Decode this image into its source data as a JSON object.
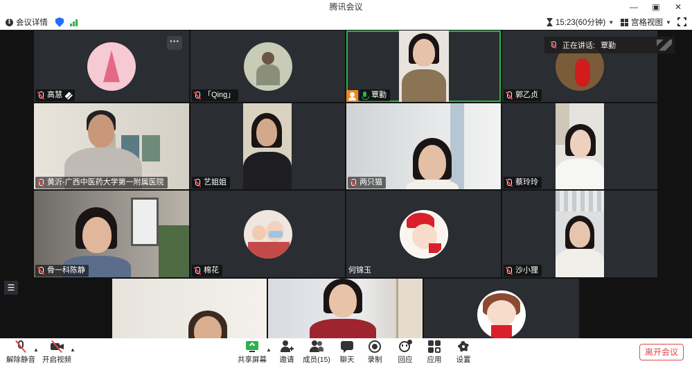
{
  "window": {
    "title": "腾讯会议",
    "controls": [
      "—",
      "▣",
      "✕"
    ]
  },
  "infobar": {
    "meeting_info_label": "会议详情",
    "timer_text": "15:23(60分钟)",
    "view_label": "宫格视图"
  },
  "speaker": {
    "prefix": "正在讲话:",
    "name": "覃勤"
  },
  "participants": [
    {
      "name": "高慧"
    },
    {
      "name": "「Qing」"
    },
    {
      "name": "覃勤"
    },
    {
      "name": "郭乙贞"
    },
    {
      "name": "黄沂-广西中医药大学第一附属医院"
    },
    {
      "name": "艺姐姐"
    },
    {
      "name": "两只猫"
    },
    {
      "name": "蔡玲玲"
    },
    {
      "name": "骨一科陈静"
    },
    {
      "name": "棉花"
    },
    {
      "name": "何锦玉"
    },
    {
      "name": "沙小狸"
    }
  ],
  "toolbar": {
    "unmute": "解除静音",
    "start_video": "开启视频",
    "share_screen": "共享屏幕",
    "invite": "邀请",
    "members": "成员(15)",
    "chat": "聊天",
    "record": "录制",
    "reaction": "回应",
    "apps": "应用",
    "settings": "设置",
    "leave": "离开会议"
  },
  "colors": {
    "speaking_border": "#2bb24c",
    "leave_red": "#e04a4a",
    "stage_bg": "#121212",
    "tile_bg": "#2a2d31"
  }
}
